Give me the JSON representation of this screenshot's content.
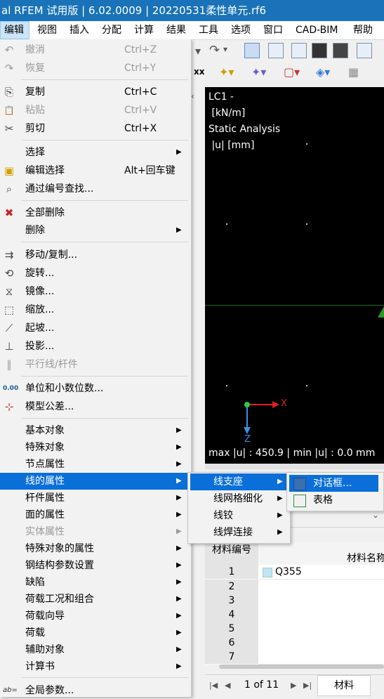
{
  "window": {
    "title": "al RFEM 试用版 | 6.02.0009 | 20220531柔性单元.rf6"
  },
  "menubar": [
    {
      "label": "编辑",
      "active": true
    },
    {
      "label": "视图"
    },
    {
      "label": "插入"
    },
    {
      "label": "分配"
    },
    {
      "label": "计算"
    },
    {
      "label": "结果"
    },
    {
      "label": "工具"
    },
    {
      "label": "选项"
    },
    {
      "label": "窗口"
    },
    {
      "label": "CAD-BIM"
    },
    {
      "label": "帮助"
    }
  ],
  "edit_menu": {
    "items": [
      {
        "label": "撤消",
        "shortcut": "Ctrl+Z",
        "icon": "undo-icon",
        "glyph": "↶",
        "disabled": true
      },
      {
        "label": "恢复",
        "shortcut": "Ctrl+Y",
        "icon": "redo-icon",
        "glyph": "↷",
        "disabled": true
      },
      {
        "label": "复制",
        "shortcut": "Ctrl+C",
        "icon": "copy-icon",
        "glyph": "⎘"
      },
      {
        "label": "粘贴",
        "shortcut": "Ctrl+V",
        "icon": "paste-icon",
        "glyph": "📋",
        "disabled": true
      },
      {
        "label": "剪切",
        "shortcut": "Ctrl+X",
        "icon": "cut-icon",
        "glyph": "✂"
      },
      {
        "label": "选择",
        "submenu": true
      },
      {
        "label": "编辑选择",
        "shortcut": "Alt+回车键",
        "icon": "edit-selection-icon",
        "glyph": "▣"
      },
      {
        "label": "通过编号查找...",
        "icon": "binoculars-icon",
        "glyph": "⌕"
      },
      {
        "label": "全部删除",
        "icon": "delete-all-icon",
        "glyph": "✖"
      },
      {
        "label": "删除",
        "submenu": true
      },
      {
        "label": "移动/复制...",
        "icon": "move-copy-icon",
        "glyph": "⇉"
      },
      {
        "label": "旋转...",
        "icon": "rotate-icon",
        "glyph": "⟲"
      },
      {
        "label": "镜像...",
        "icon": "mirror-icon",
        "glyph": "⧖"
      },
      {
        "label": "缩放...",
        "icon": "scale-icon",
        "glyph": "⬚"
      },
      {
        "label": "起坡...",
        "icon": "slope-icon",
        "glyph": "⟋"
      },
      {
        "label": "投影...",
        "icon": "projection-icon",
        "glyph": "⊥"
      },
      {
        "label": "平行线/杆件",
        "icon": "parallel-lines-icon",
        "glyph": "∥",
        "disabled": true
      },
      {
        "label": "单位和小数位数...",
        "icon": "units-icon",
        "glyph": "0.00"
      },
      {
        "label": "模型公差...",
        "icon": "tolerance-icon",
        "glyph": "⊹"
      },
      {
        "label": "基本对象",
        "submenu": true
      },
      {
        "label": "特殊对象",
        "submenu": true
      },
      {
        "label": "节点属性",
        "submenu": true
      },
      {
        "label": "线的属性",
        "submenu": true,
        "highlighted": true
      },
      {
        "label": "杆件属性",
        "submenu": true
      },
      {
        "label": "面的属性",
        "submenu": true
      },
      {
        "label": "实体属性",
        "submenu": true,
        "disabled": true
      },
      {
        "label": "特殊对象的属性",
        "submenu": true
      },
      {
        "label": "钢结构参数设置",
        "submenu": true
      },
      {
        "label": "缺陷",
        "submenu": true
      },
      {
        "label": "荷载工况和组合",
        "submenu": true
      },
      {
        "label": "荷载向导",
        "submenu": true
      },
      {
        "label": "荷载",
        "submenu": true
      },
      {
        "label": "辅助对象",
        "submenu": true
      },
      {
        "label": "计算书",
        "submenu": true
      },
      {
        "label": "全局参数...",
        "icon": "global-params-icon",
        "glyph": "ab="
      }
    ]
  },
  "line_props_submenu": [
    {
      "label": "线支座",
      "submenu": true,
      "highlighted": true
    },
    {
      "label": "线网格细化",
      "submenu": true
    },
    {
      "label": "线铰",
      "submenu": true
    },
    {
      "label": "线焊连接",
      "submenu": true
    }
  ],
  "line_support_submenu": [
    {
      "label": "对话框...",
      "icon": "dialog-icon",
      "highlighted": true
    },
    {
      "label": "表格",
      "icon": "table-icon"
    }
  ],
  "viewport": {
    "lines": [
      "LC1 -",
      " [kN/m]",
      "Static Analysis",
      " |u| [mm]"
    ],
    "axis_x": "X",
    "axis_z": "Z",
    "footer": "max |u| : 450.9 | min |u| : 0.0 mm"
  },
  "materials_table": {
    "headers": [
      "材料编号",
      "材料名称"
    ],
    "rows": [
      {
        "no": "1",
        "name": "Q355"
      },
      {
        "no": "2",
        "name": ""
      },
      {
        "no": "3",
        "name": ""
      },
      {
        "no": "4",
        "name": ""
      },
      {
        "no": "5",
        "name": ""
      },
      {
        "no": "6",
        "name": ""
      },
      {
        "no": "7",
        "name": ""
      }
    ],
    "pager": "1 of 11",
    "tab": "材料"
  }
}
